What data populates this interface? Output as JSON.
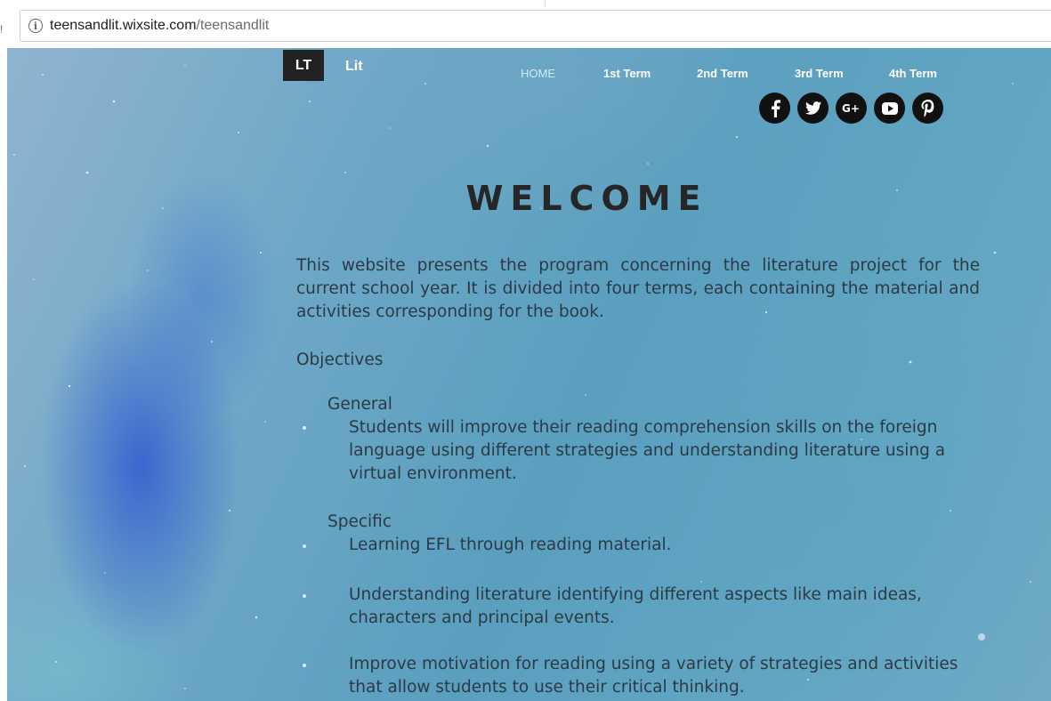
{
  "browser": {
    "url_domain": "teensandlit.wixsite.com",
    "url_path": "/teensandlit",
    "edge_glyph": "!"
  },
  "header": {
    "logo": "LT",
    "site_name": "Lit",
    "nav": [
      "HOME",
      "1st Term",
      "2nd Term",
      "3rd Term",
      "4th Term"
    ],
    "social_icons": [
      "facebook-icon",
      "twitter-icon",
      "google-plus-icon",
      "youtube-icon",
      "pinterest-icon"
    ]
  },
  "content": {
    "title": "WELCOME",
    "intro": "This website presents the program concerning the literature project for the current school year. It is divided into four terms, each containing the material and activities corresponding for the book.",
    "objectives_heading": "Objectives",
    "general_heading": "General",
    "general_items": [
      "Students will improve their reading comprehension skills on the foreign language using different strategies and understanding literature using a virtual environment."
    ],
    "specific_heading": "Specific",
    "specific_items": [
      "Learning EFL through reading material.",
      "Understanding literature identifying different aspects like main ideas, characters and principal events.",
      "Improve motivation for reading using a variety of strategies and activities that allow students to use their critical thinking."
    ]
  },
  "colors": {
    "logo_bg": "#222222",
    "title": "#262626",
    "body_text": "#2b3a44",
    "social_bg": "#111111"
  }
}
